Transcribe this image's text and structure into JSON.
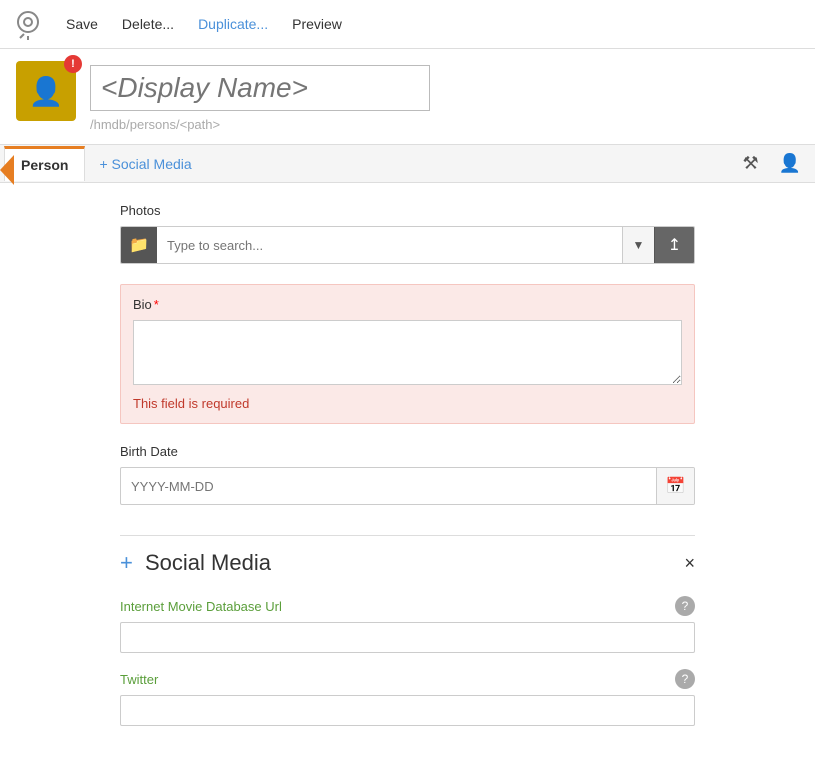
{
  "toolbar": {
    "save_label": "Save",
    "delete_label": "Delete...",
    "duplicate_label": "Duplicate...",
    "preview_label": "Preview"
  },
  "header": {
    "display_name_placeholder": "<Display Name>",
    "path": "/hmdb/persons/",
    "path_placeholder": "<path>"
  },
  "avatar": {
    "error_badge": "!"
  },
  "tabs": {
    "active_tab": "Person",
    "add_tab": "+ Social Media"
  },
  "photos": {
    "label": "Photos",
    "search_placeholder": "Type to search..."
  },
  "bio": {
    "label": "Bio",
    "required": true,
    "error_message": "This field is required"
  },
  "birth_date": {
    "label": "Birth Date",
    "placeholder": "YYYY-MM-DD"
  },
  "social_media": {
    "title": "+ Social Media",
    "sections": [
      {
        "label": "Internet Movie Database Url",
        "name": "imdb-url"
      },
      {
        "label": "Twitter",
        "name": "twitter"
      }
    ]
  }
}
